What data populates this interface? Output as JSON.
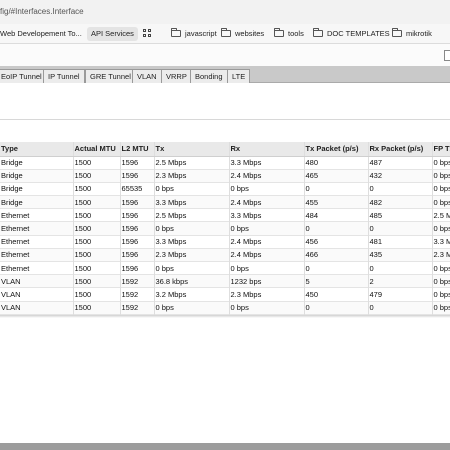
{
  "browser": {
    "url_fragment": "fig/#Interfaces.Interface"
  },
  "bookmarks": [
    {
      "label": "Web Developement To...",
      "type": "bookmark"
    },
    {
      "label": "API Services",
      "type": "pill"
    },
    {
      "label": "",
      "type": "apps-grid-icon"
    },
    {
      "label": "javascript",
      "type": "folder"
    },
    {
      "label": "websites",
      "type": "folder"
    },
    {
      "label": "tools",
      "type": "folder"
    },
    {
      "label": "DOC TEMPLATES",
      "type": "folder"
    },
    {
      "label": "mikrotik",
      "type": "folder"
    }
  ],
  "tabs": [
    "EoIP Tunnel",
    "IP Tunnel",
    "GRE Tunnel",
    "VLAN",
    "VRRP",
    "Bonding",
    "LTE"
  ],
  "table": {
    "columns": [
      "Type",
      "Actual MTU",
      "L2 MTU",
      "Tx",
      "Rx",
      "Tx Packet (p/s)",
      "Rx Packet (p/s)",
      "FP Tx"
    ],
    "rows": [
      [
        "Bridge",
        "1500",
        "1596",
        "2.5 Mbps",
        "3.3 Mbps",
        "480",
        "487",
        "0 bps"
      ],
      [
        "Bridge",
        "1500",
        "1596",
        "2.3 Mbps",
        "2.4 Mbps",
        "465",
        "432",
        "0 bps"
      ],
      [
        "Bridge",
        "1500",
        "65535",
        "0 bps",
        "0 bps",
        "0",
        "0",
        "0 bps"
      ],
      [
        "Bridge",
        "1500",
        "1596",
        "3.3 Mbps",
        "2.4 Mbps",
        "455",
        "482",
        "0 bps"
      ],
      [
        "Ethernet",
        "1500",
        "1596",
        "2.5 Mbps",
        "3.3 Mbps",
        "484",
        "485",
        "2.5 M"
      ],
      [
        "Ethernet",
        "1500",
        "1596",
        "0 bps",
        "0 bps",
        "0",
        "0",
        "0 bps"
      ],
      [
        "Ethernet",
        "1500",
        "1596",
        "3.3 Mbps",
        "2.4 Mbps",
        "456",
        "481",
        "3.3 M"
      ],
      [
        "Ethernet",
        "1500",
        "1596",
        "2.3 Mbps",
        "2.4 Mbps",
        "466",
        "435",
        "2.3 M"
      ],
      [
        "Ethernet",
        "1500",
        "1596",
        "0 bps",
        "0 bps",
        "0",
        "0",
        "0 bps"
      ],
      [
        "VLAN",
        "1500",
        "1592",
        "36.8 kbps",
        "1232 bps",
        "5",
        "2",
        "0 bps"
      ],
      [
        "VLAN",
        "1500",
        "1592",
        "3.2 Mbps",
        "2.3 Mbps",
        "450",
        "479",
        "0 bps"
      ],
      [
        "VLAN",
        "1500",
        "1592",
        "0 bps",
        "0 bps",
        "0",
        "0",
        "0 bps"
      ]
    ]
  }
}
